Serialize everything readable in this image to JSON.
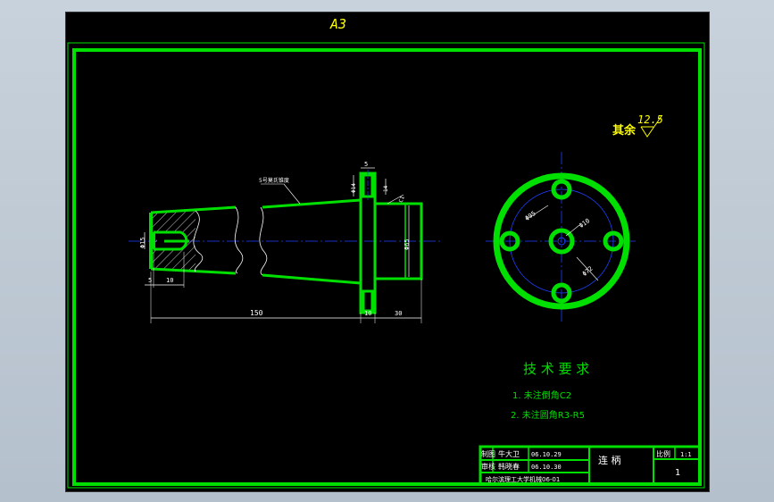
{
  "sheet": {
    "size_label": "A3"
  },
  "roughness": {
    "prefix": "其余",
    "value": "12.5"
  },
  "dimensions": {
    "d15": "Φ15",
    "len_5": "5",
    "len_10a": "10",
    "len_150": "150",
    "len_10b": "10",
    "len_30": "30",
    "top_5": "5",
    "d14": "Φ14",
    "r14": "14",
    "c1": "C1",
    "d65": "Φ65",
    "taper_label": "5号莫氏锥度",
    "circle_d95": "Φ95",
    "circle_d10": "Φ10",
    "circle_d72": "Φ72"
  },
  "requirements": {
    "title": "技 术 要 求",
    "items": [
      "1. 未注倒角C2",
      "2. 未注圆角R3-R5"
    ]
  },
  "title_block": {
    "row1_label": "制图",
    "row1_name": "牛大卫",
    "row1_date": "06.10.29",
    "row2_label": "审核",
    "row2_name": "韩晓春",
    "row2_date": "06.10.30",
    "school": "哈尔滨理工大学机械06-01",
    "part_name": "连 柄",
    "scale_label": "比例",
    "scale_value": "1:1",
    "qty_value": "1"
  },
  "colors": {
    "outline": "#00e000",
    "dimension": "#ffffff",
    "centerline": "#2040ff",
    "annotation": "#ffff00",
    "hatch": "#ffffff"
  }
}
